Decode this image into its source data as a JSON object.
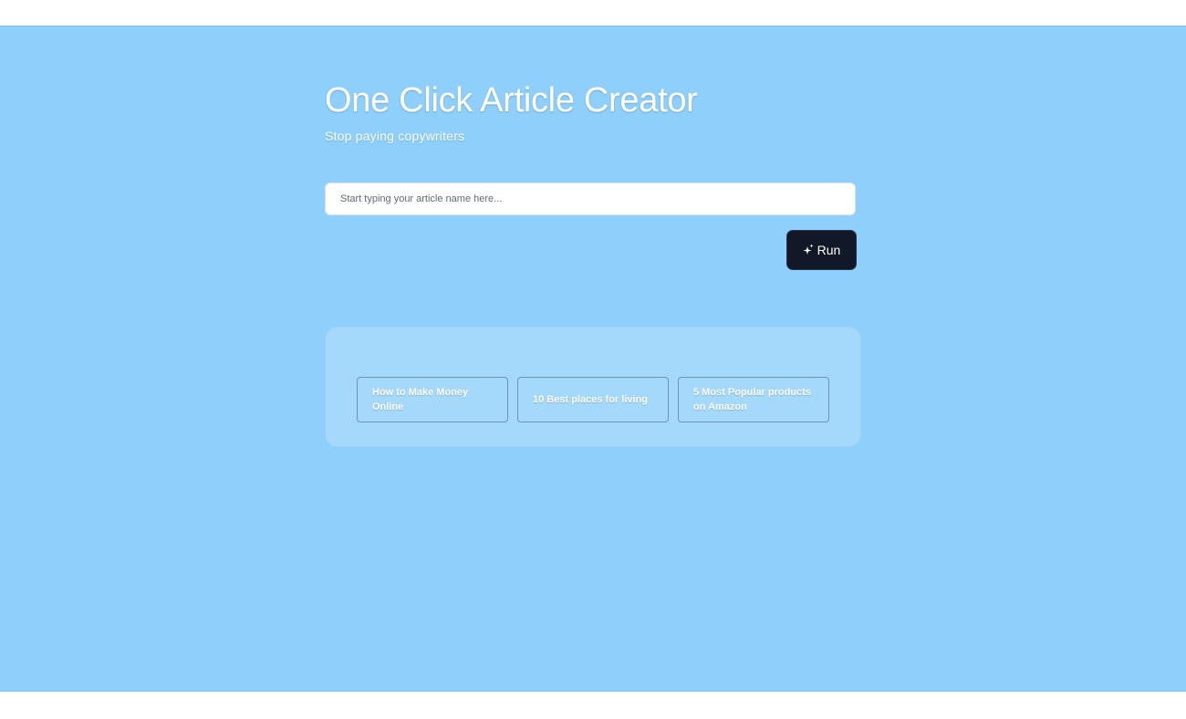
{
  "header": {
    "title": "One Click Article Creator",
    "subtitle": "Stop paying copywriters"
  },
  "search": {
    "placeholder": "Start typing your article name here...",
    "value": ""
  },
  "run_button": {
    "label": "Run",
    "icon": "sparkles-icon"
  },
  "suggestions": [
    {
      "label": "How to Make Money Online"
    },
    {
      "label": "10 Best places for living"
    },
    {
      "label": "5 Most Popular products on Amazon"
    }
  ],
  "colors": {
    "background": "#8ed0fb",
    "panel": "#a5d9fb",
    "button": "#111827",
    "text": "#ffffff"
  }
}
